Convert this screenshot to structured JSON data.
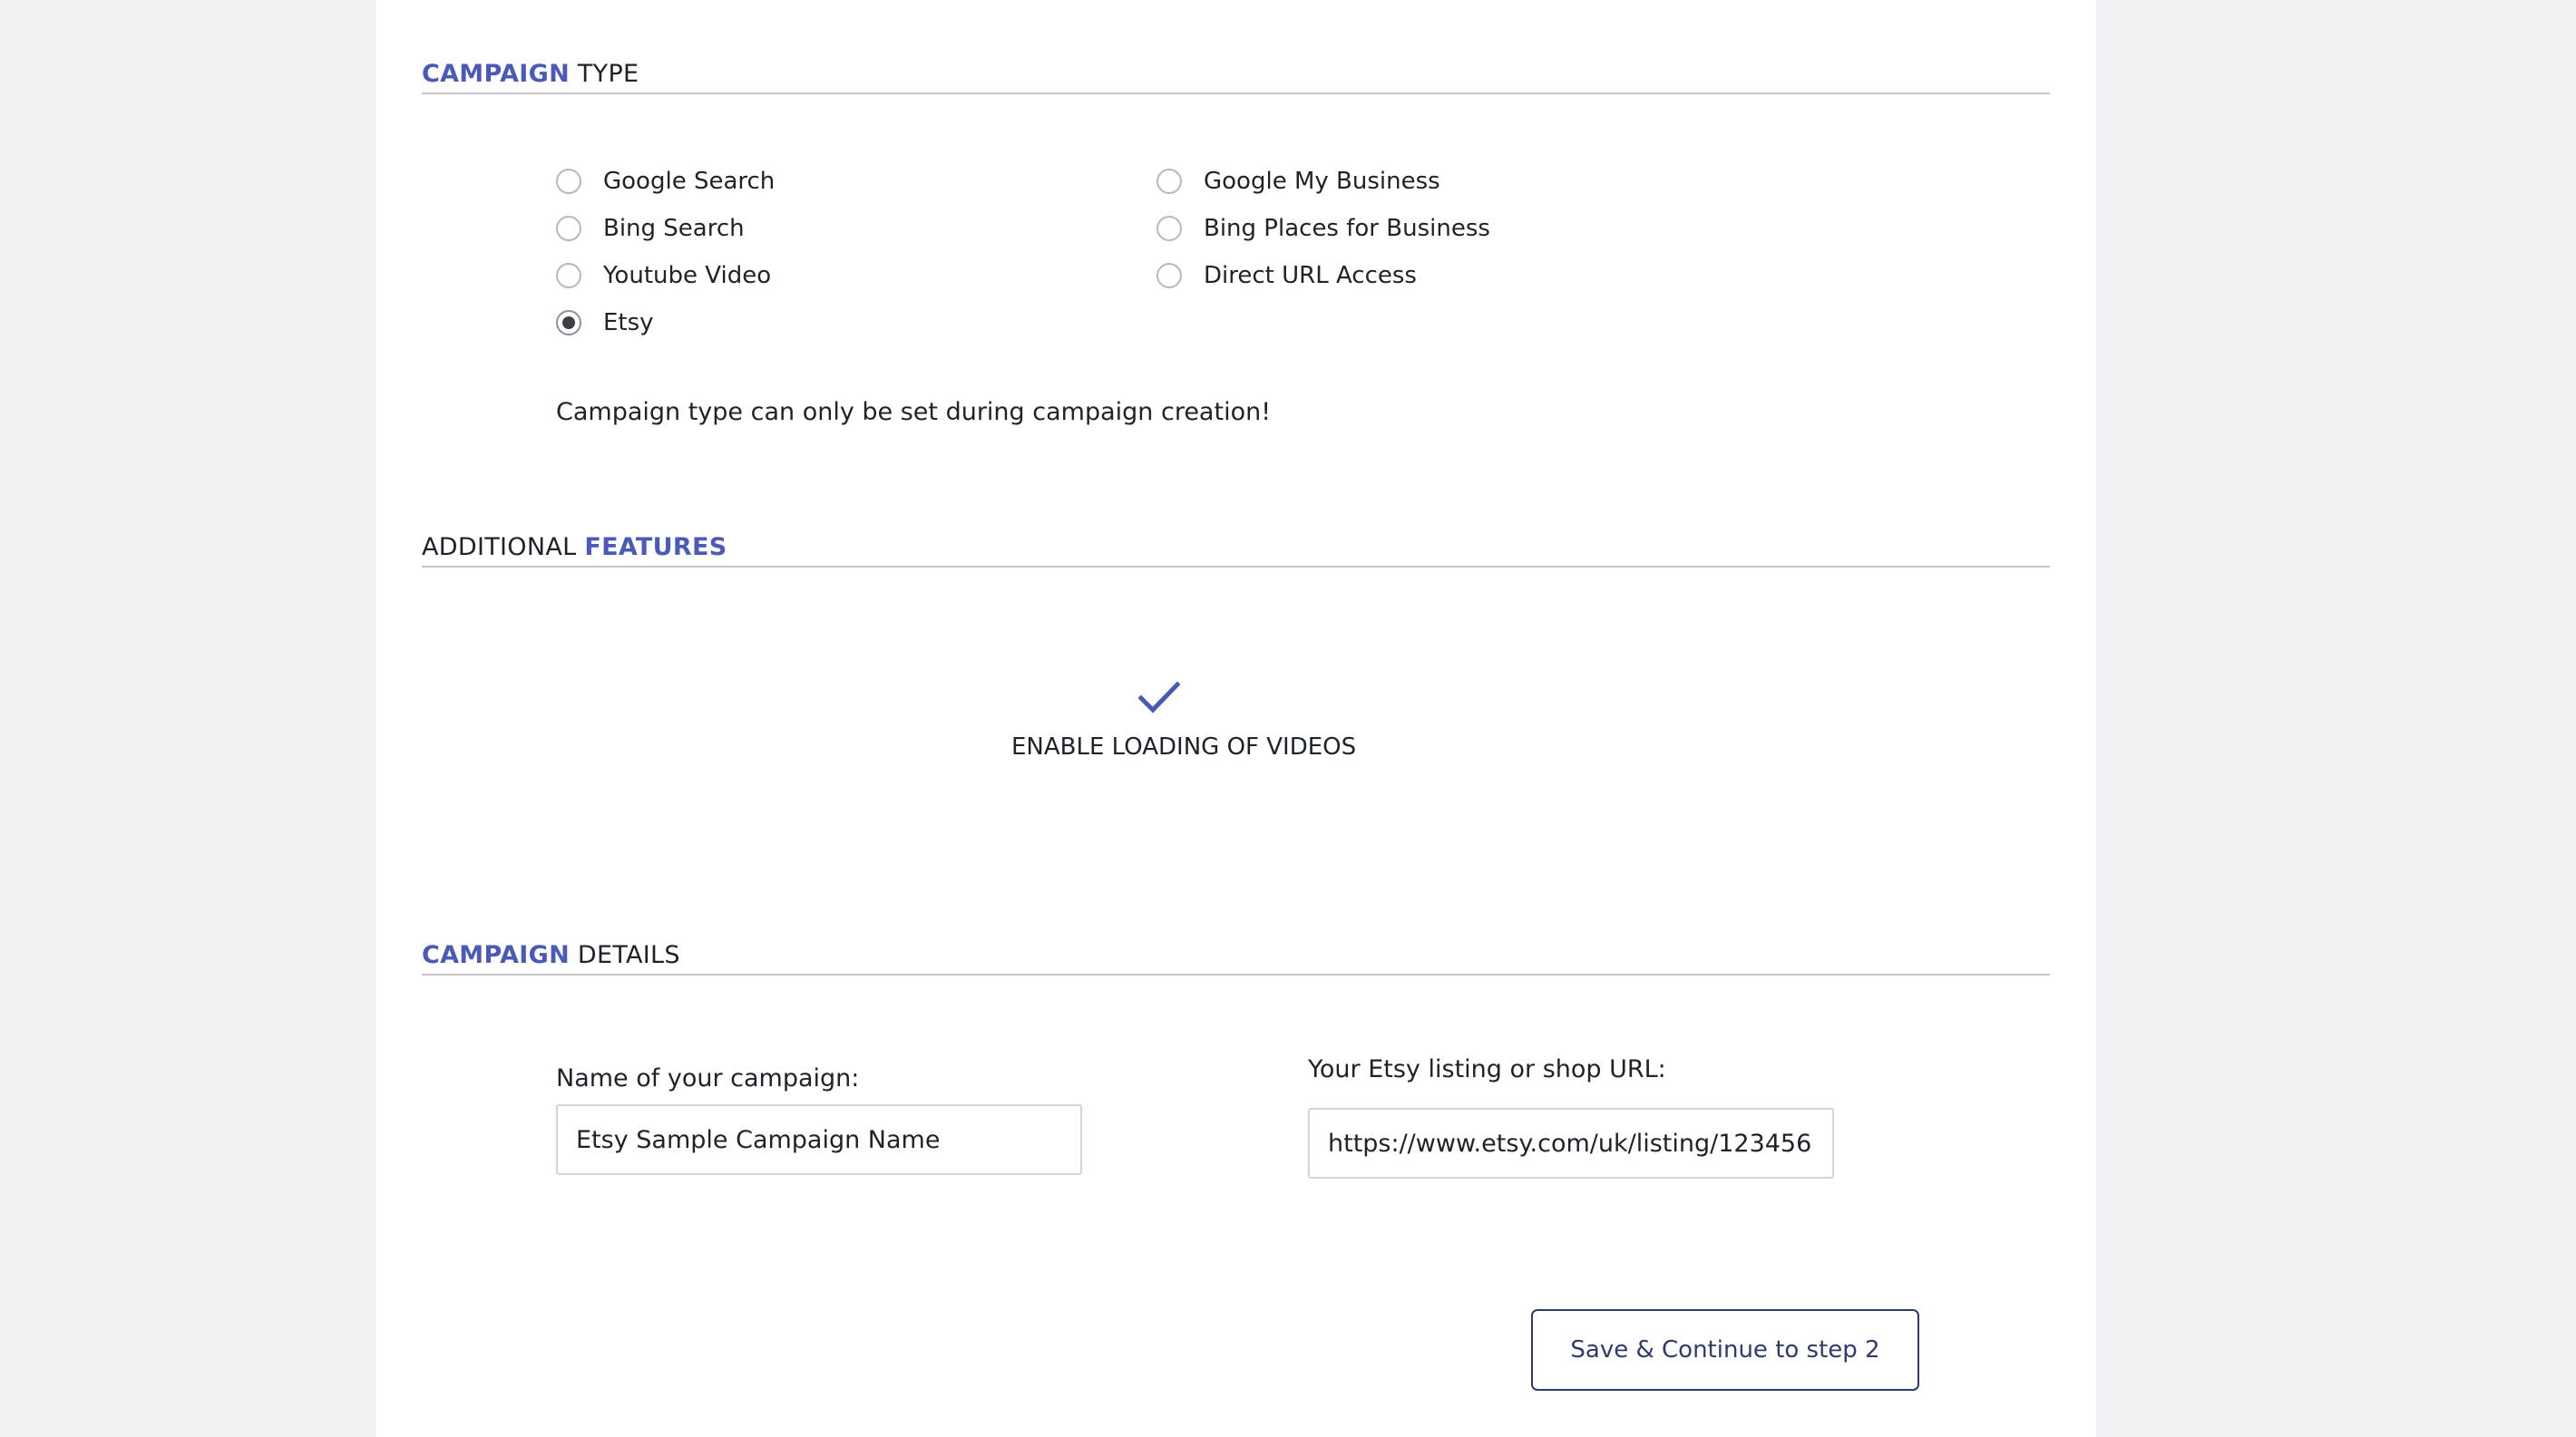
{
  "campaign_type": {
    "heading_accent": "CAMPAIGN",
    "heading_rest": " TYPE",
    "options": [
      {
        "label": "Google Search",
        "checked": false
      },
      {
        "label": "Bing Search",
        "checked": false
      },
      {
        "label": "Youtube Video",
        "checked": false
      },
      {
        "label": "Etsy",
        "checked": true
      },
      {
        "label": "Google My Business",
        "checked": false
      },
      {
        "label": "Bing Places for Business",
        "checked": false
      },
      {
        "label": "Direct URL Access",
        "checked": false
      }
    ],
    "note": "Campaign type can only be set during campaign creation!"
  },
  "additional_features": {
    "heading_plain": "ADDITIONAL ",
    "heading_accent": "FEATURES",
    "enable_videos": {
      "label": "ENABLE LOADING OF VIDEOS",
      "icon": "check-icon",
      "checked": true
    }
  },
  "campaign_details": {
    "heading_accent": "CAMPAIGN",
    "heading_rest": " DETAILS",
    "name_label": "Name of your campaign:",
    "name_value": "Etsy Sample Campaign Name",
    "url_label": "Your Etsy listing or shop URL:",
    "url_value": "https://www.etsy.com/uk/listing/123456"
  },
  "actions": {
    "save_label": "Save & Continue to step 2"
  },
  "colors": {
    "accent": "#4a5ab8",
    "button_border": "#2f3a6e",
    "page_background": "#f1f2f6",
    "panel_background": "#ffffff"
  }
}
